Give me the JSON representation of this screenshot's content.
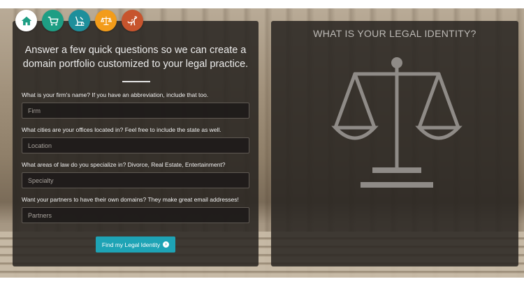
{
  "nav": {
    "items": [
      {
        "name": "home",
        "color": "#ffffff"
      },
      {
        "name": "shopping-cart",
        "color": "#1e9e84"
      },
      {
        "name": "dentist-chair",
        "color": "#1e8f9b"
      },
      {
        "name": "legal-scales",
        "color": "#f39c1a"
      },
      {
        "name": "dinosaur",
        "color": "#c7542d"
      }
    ]
  },
  "form": {
    "intro": "Answer a few quick questions so we can create a domain portfolio customized to your legal practice.",
    "questions": [
      {
        "label": "What is your firm's name? If you have an abbreviation, include that too.",
        "placeholder": "Firm"
      },
      {
        "label": "What cities are your offices located in? Feel free to include the state as well.",
        "placeholder": "Location"
      },
      {
        "label": "What areas of law do you specialize in? Divorce, Real Estate, Entertainment?",
        "placeholder": "Specialty"
      },
      {
        "label": "Want your partners to have their own domains? They make great email addresses!",
        "placeholder": "Partners"
      }
    ],
    "submit_label": "Find my Legal Identity"
  },
  "identity": {
    "title": "WHAT IS YOUR LEGAL IDENTITY?",
    "icon": "scales-of-justice-icon"
  }
}
